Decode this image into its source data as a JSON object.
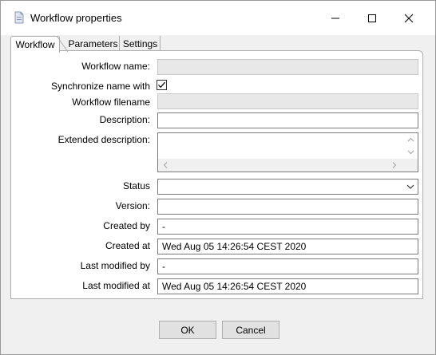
{
  "window": {
    "title": "Workflow properties",
    "icon": "document-icon",
    "controls": [
      "minimize-icon",
      "maximize-icon",
      "close-icon"
    ]
  },
  "tabs": [
    "Workflow",
    "Parameters",
    "Settings"
  ],
  "form": {
    "workflow_name_label": "Workflow name:",
    "workflow_name_value": "",
    "sync_label": "Synchronize name with",
    "sync_checked": true,
    "filename_label": "Workflow filename",
    "filename_value": "",
    "description_label": "Description:",
    "description_value": "",
    "extended_label": "Extended description:",
    "extended_value": "",
    "status_label": "Status",
    "status_value": "",
    "version_label": "Version:",
    "version_value": "",
    "created_by_label": "Created by",
    "created_by_value": "-",
    "created_at_label": "Created at",
    "created_at_value": "Wed Aug 05 14:26:54 CEST 2020",
    "modified_by_label": "Last modified by",
    "modified_by_value": "-",
    "modified_at_label": "Last modified at",
    "modified_at_value": "Wed Aug 05 14:26:54 CEST 2020"
  },
  "buttons": {
    "ok": "OK",
    "cancel": "Cancel"
  }
}
